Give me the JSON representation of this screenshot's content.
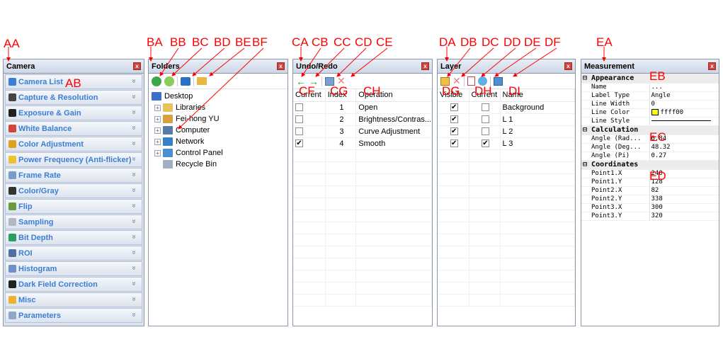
{
  "camera": {
    "title": "Camera",
    "items": [
      {
        "label": "Camera List",
        "color": "#3a7fd5"
      },
      {
        "label": "Capture & Resolution",
        "color": "#444444"
      },
      {
        "label": "Exposure & Gain",
        "color": "#222222"
      },
      {
        "label": "White Balance",
        "color": "#d0453d"
      },
      {
        "label": "Color Adjustment",
        "color": "#e0a020"
      },
      {
        "label": "Power Frequency (Anti-flicker)",
        "color": "#f0c030"
      },
      {
        "label": "Frame Rate",
        "color": "#7a9acc"
      },
      {
        "label": "Color/Gray",
        "color": "#333333"
      },
      {
        "label": "Flip",
        "color": "#6a9a40"
      },
      {
        "label": "Sampling",
        "color": "#b0b8c4"
      },
      {
        "label": "Bit Depth",
        "color": "#2aa060"
      },
      {
        "label": "ROI",
        "color": "#5070a0"
      },
      {
        "label": "Histogram",
        "color": "#7090c8"
      },
      {
        "label": "Dark Field Correction",
        "color": "#222222"
      },
      {
        "label": "Misc",
        "color": "#f0b030"
      },
      {
        "label": "Parameters",
        "color": "#90a8c8"
      }
    ]
  },
  "folders": {
    "title": "Folders",
    "tree": [
      {
        "label": "Desktop",
        "level": 0,
        "icon": "desktop-icon",
        "color": "#3c6fc8"
      },
      {
        "label": "Libraries",
        "level": 1,
        "icon": "folder-icon",
        "color": "#e8c25a"
      },
      {
        "label": "Fei-hong YU",
        "level": 1,
        "icon": "user-folder-icon",
        "color": "#d8a040"
      },
      {
        "label": "Computer",
        "level": 1,
        "icon": "computer-icon",
        "color": "#5a7aa8"
      },
      {
        "label": "Network",
        "level": 1,
        "icon": "network-icon",
        "color": "#3a80c8"
      },
      {
        "label": "Control Panel",
        "level": 1,
        "icon": "control-panel-icon",
        "color": "#4a90d0"
      },
      {
        "label": "Recycle Bin",
        "level": 1,
        "icon": "recycle-bin-icon",
        "color": "#a0b0c0"
      }
    ]
  },
  "undo": {
    "title": "Undo/Redo",
    "headers": [
      "Current",
      "Index",
      "Operation"
    ],
    "rows": [
      {
        "current": false,
        "index": "1",
        "operation": "Open"
      },
      {
        "current": false,
        "index": "2",
        "operation": "Brightness/Contras..."
      },
      {
        "current": false,
        "index": "3",
        "operation": "Curve Adjustment"
      },
      {
        "current": true,
        "index": "4",
        "operation": "Smooth"
      }
    ]
  },
  "layer": {
    "title": "Layer",
    "headers": [
      "Visible",
      "Current",
      "Name"
    ],
    "rows": [
      {
        "visible": true,
        "current": false,
        "name": "Background"
      },
      {
        "visible": true,
        "current": false,
        "name": "L 1"
      },
      {
        "visible": true,
        "current": false,
        "name": "L 2"
      },
      {
        "visible": true,
        "current": true,
        "name": "L 3"
      }
    ]
  },
  "measurement": {
    "title": "Measurement",
    "categories": [
      {
        "name": "Appearance",
        "props": [
          {
            "key": "Name",
            "value": "..."
          },
          {
            "key": "Label Type",
            "value": "Angle"
          },
          {
            "key": "Line Width",
            "value": "0"
          },
          {
            "key": "Line Color",
            "value": "ffff00"
          },
          {
            "key": "Line Style",
            "value": ""
          }
        ]
      },
      {
        "name": "Calculation",
        "props": [
          {
            "key": "Angle (Rad...",
            "value": "0.84"
          },
          {
            "key": "Angle (Deg...",
            "value": "48.32"
          },
          {
            "key": "Angle (Pi)",
            "value": "0.27"
          }
        ]
      },
      {
        "name": "Coordinates",
        "props": [
          {
            "key": "Point1.X",
            "value": "240"
          },
          {
            "key": "Point1.Y",
            "value": "128"
          },
          {
            "key": "Point2.X",
            "value": "82"
          },
          {
            "key": "Point2.Y",
            "value": "338"
          },
          {
            "key": "Point3.X",
            "value": "300"
          },
          {
            "key": "Point3.Y",
            "value": "320"
          }
        ]
      }
    ]
  },
  "annotations": {
    "AA": "AA",
    "AB": "AB",
    "BA": "BA",
    "BB": "BB",
    "BC": "BC",
    "BD": "BD",
    "BE": "BE",
    "BF": "BF",
    "CA": "CA",
    "CB": "CB",
    "CC": "CC",
    "CD": "CD",
    "CE": "CE",
    "CF": "CF",
    "CG": "CG",
    "CH": "CH",
    "DA": "DA",
    "DB": "DB",
    "DC": "DC",
    "DD": "DD",
    "DE": "DE",
    "DF": "DF",
    "DG": "DG",
    "DH": "DH",
    "DI": "DI",
    "EA": "EA",
    "EB": "EB",
    "EC": "EC",
    "ED": "ED"
  }
}
